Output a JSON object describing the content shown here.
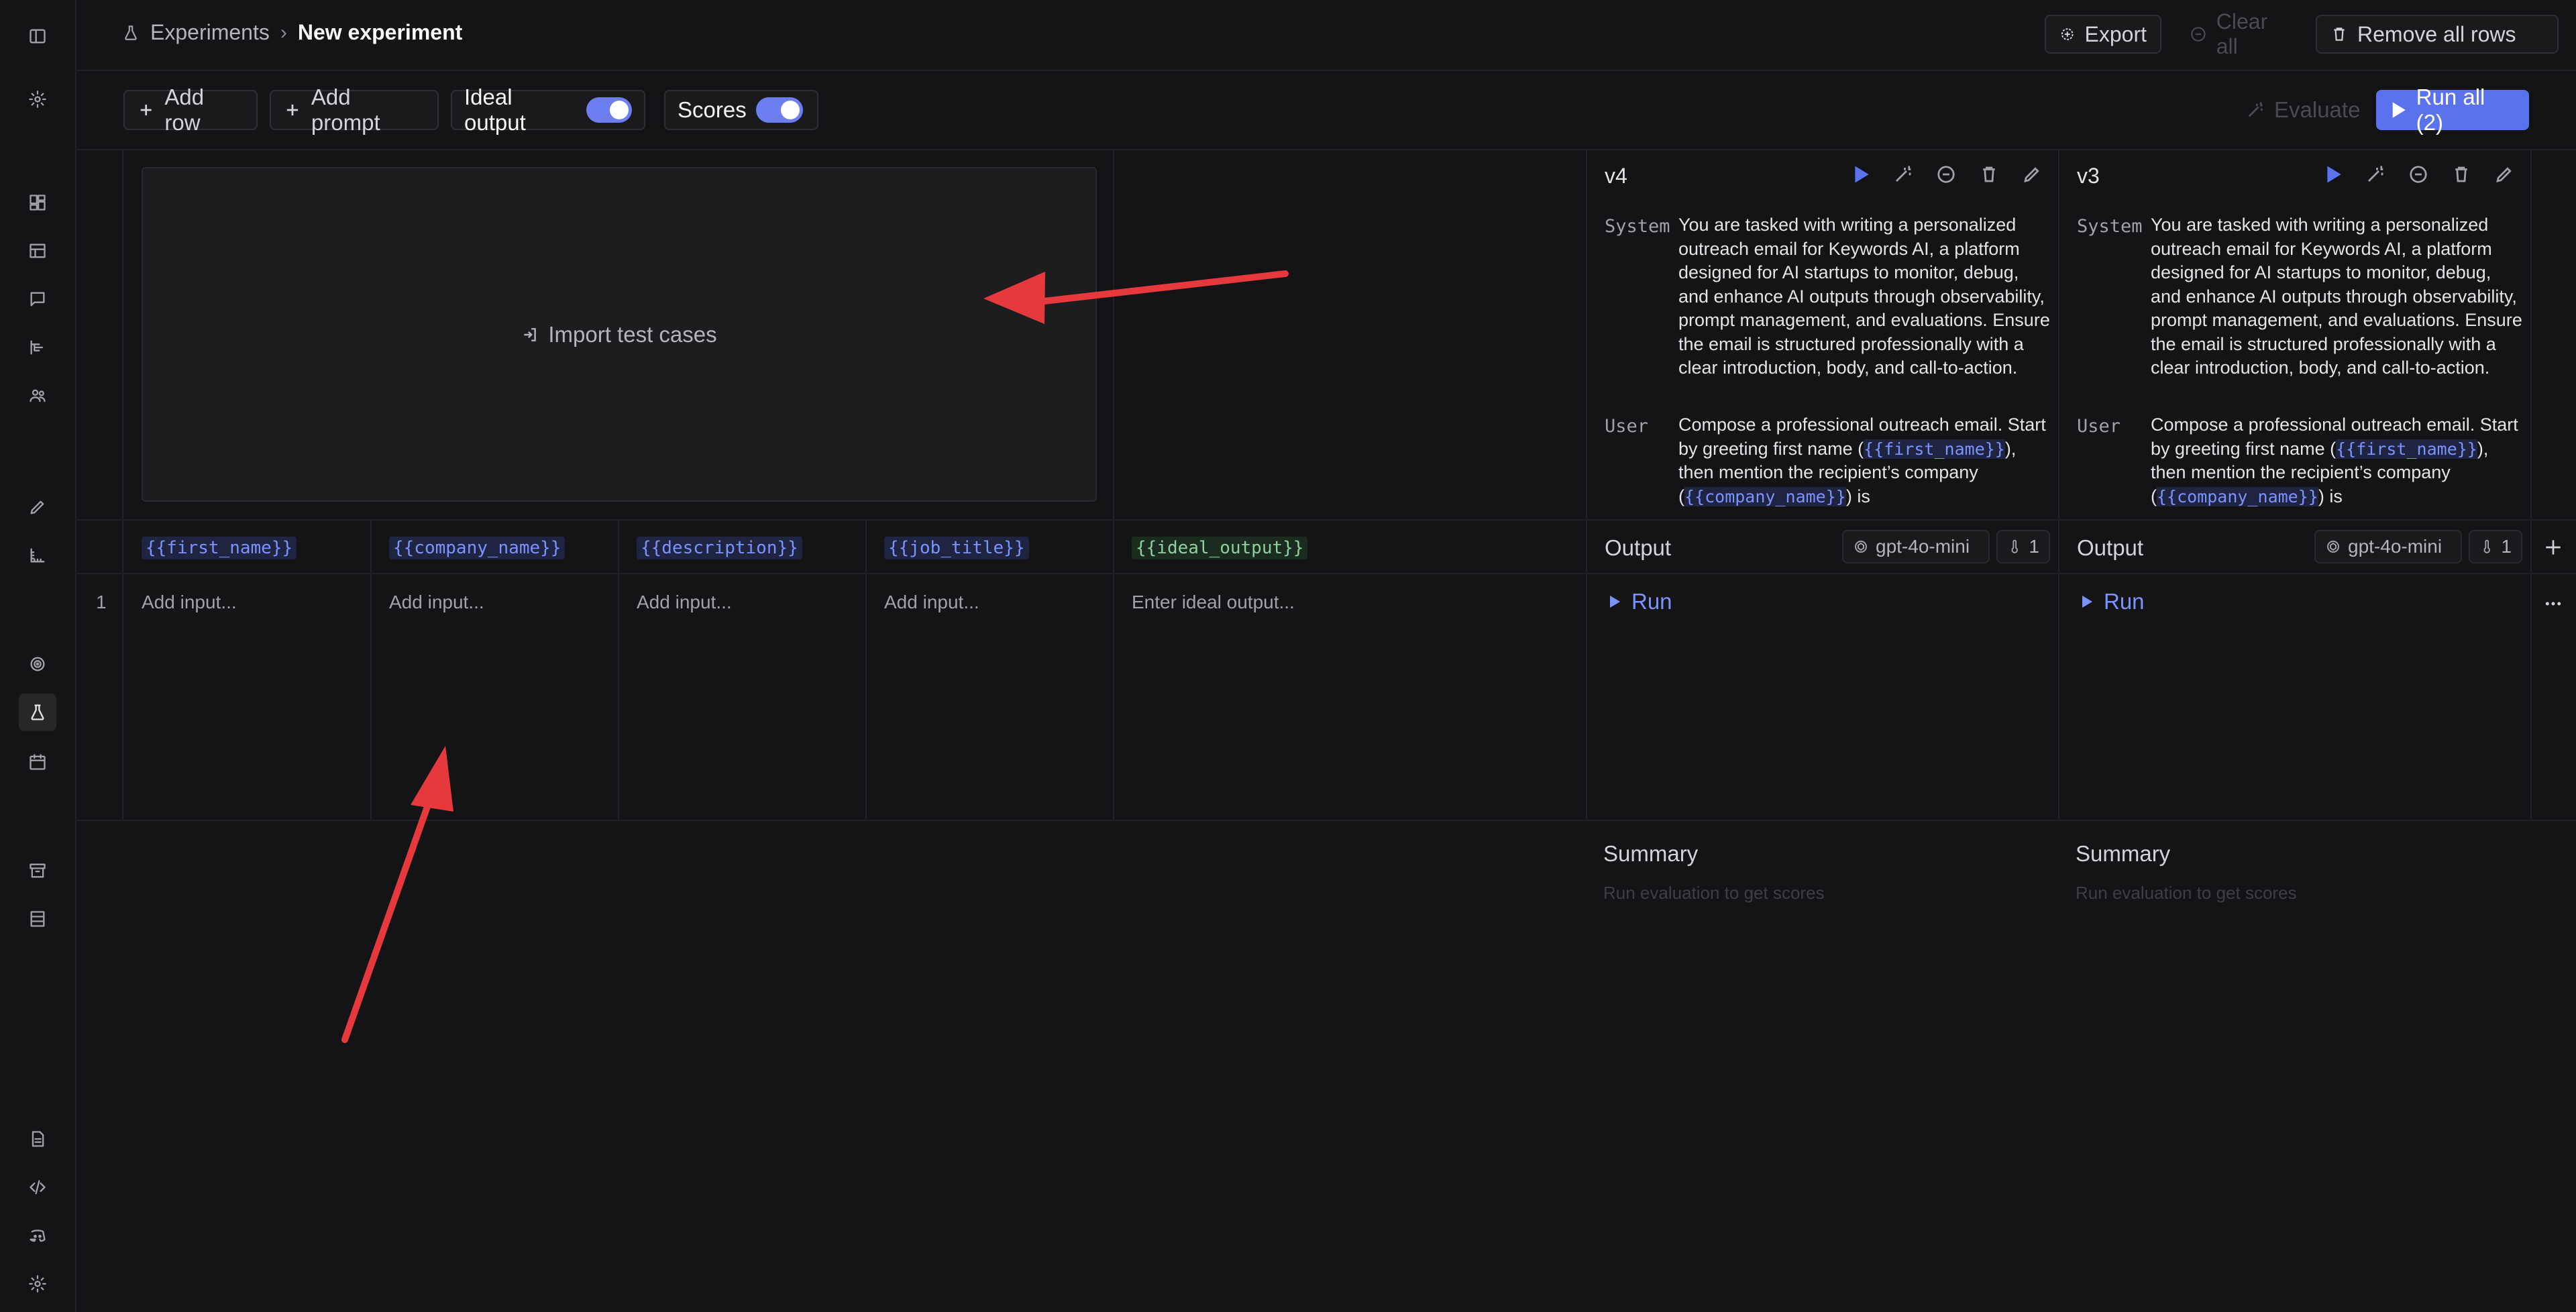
{
  "breadcrumb": {
    "section": "Experiments",
    "separator": "›",
    "current": "New experiment"
  },
  "header_actions": {
    "export": "Export",
    "clear_all": "Clear all",
    "remove_all_rows": "Remove all rows"
  },
  "toolbar": {
    "add_row": "Add row",
    "add_prompt": "Add prompt",
    "ideal_output": "Ideal output",
    "ideal_output_on": true,
    "scores": "Scores",
    "scores_on": true,
    "evaluate": "Evaluate",
    "run_all": "Run all (2)"
  },
  "import": {
    "label": "Import test cases"
  },
  "variables": [
    "{{first_name}}",
    "{{company_name}}",
    "{{description}}",
    "{{job_title}}"
  ],
  "ideal_output_var": "{{ideal_output}}",
  "row": {
    "number": "1",
    "input_placeholder": "Add input...",
    "ideal_placeholder": "Enter ideal output..."
  },
  "prompts": [
    {
      "version": "v4",
      "system_label": "System",
      "system_text": "You are tasked with writing a personalized outreach email for Keywords AI, a platform designed for AI startups to monitor, debug, and enhance AI outputs through observability, prompt management, and evaluations. Ensure the email is structured professionally with a clear introduction, body, and call-to-action.",
      "user_label": "User",
      "user_text_a": "Compose a professional outreach email. Start by greeting first name (",
      "user_var_a": "{{first_name}}",
      "user_text_b": "), then mention the recipient’s company (",
      "user_var_b": "{{company_name}}",
      "user_text_c": ") is",
      "output_label": "Output",
      "model": "gpt-4o-mini",
      "temperature": "1",
      "run": "Run",
      "summary": "Summary",
      "summary_hint": "Run evaluation to get scores"
    },
    {
      "version": "v3",
      "system_label": "System",
      "system_text": "You are tasked with writing a personalized outreach email for Keywords AI, a platform designed for AI startups to monitor, debug, and enhance AI outputs through observability, prompt management, and evaluations. Ensure the email is structured professionally with a clear introduction, body, and call-to-action.",
      "user_label": "User",
      "user_text_a": "Compose a professional outreach email. Start by greeting first name (",
      "user_var_a": "{{first_name}}",
      "user_text_b": "), then mention the recipient’s company (",
      "user_var_b": "{{company_name}}",
      "user_text_c": ") is",
      "output_label": "Output",
      "model": "gpt-4o-mini",
      "temperature": "1",
      "run": "Run",
      "summary": "Summary",
      "summary_hint": "Run evaluation to get scores"
    }
  ],
  "colors": {
    "accent": "#5b72ee",
    "variable": "#7b93ff",
    "ideal_variable": "#8fd19e",
    "annotation_arrow": "#e5393d",
    "background": "#141416"
  }
}
